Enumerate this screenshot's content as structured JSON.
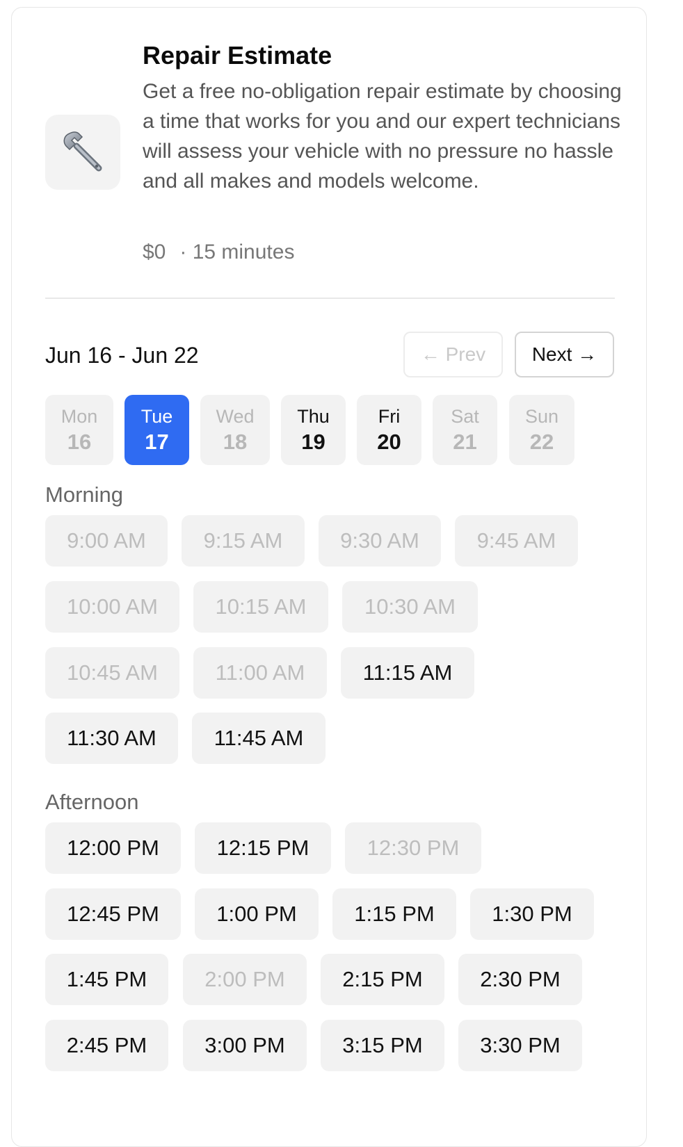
{
  "service": {
    "icon": "wrench-icon",
    "title": "Repair Estimate",
    "description": "Get a free no-obligation repair estimate by choosing a time that works for you and our expert technicians will assess your vehicle with no pressure no hassle and all makes and models welcome.",
    "price": "$0",
    "duration": "· 15 minutes"
  },
  "week": {
    "range": "Jun 16 - Jun 22",
    "prev_label": "← Prev",
    "next_label": "Next →",
    "days": [
      {
        "name": "Mon",
        "num": "16",
        "state": "disabled"
      },
      {
        "name": "Tue",
        "num": "17",
        "state": "selected"
      },
      {
        "name": "Wed",
        "num": "18",
        "state": "disabled"
      },
      {
        "name": "Thu",
        "num": "19",
        "state": "enabled"
      },
      {
        "name": "Fri",
        "num": "20",
        "state": "enabled"
      },
      {
        "name": "Sat",
        "num": "21",
        "state": "disabled"
      },
      {
        "name": "Sun",
        "num": "22",
        "state": "disabled"
      }
    ]
  },
  "morning": {
    "label": "Morning",
    "slots": [
      {
        "time": "9:00 AM",
        "available": false
      },
      {
        "time": "9:15 AM",
        "available": false
      },
      {
        "time": "9:30 AM",
        "available": false
      },
      {
        "time": "9:45 AM",
        "available": false
      },
      {
        "time": "10:00 AM",
        "available": false
      },
      {
        "time": "10:15 AM",
        "available": false
      },
      {
        "time": "10:30 AM",
        "available": false
      },
      {
        "time": "10:45 AM",
        "available": false
      },
      {
        "time": "11:00 AM",
        "available": false
      },
      {
        "time": "11:15 AM",
        "available": true
      },
      {
        "time": "11:30 AM",
        "available": true
      },
      {
        "time": "11:45 AM",
        "available": true
      }
    ]
  },
  "afternoon": {
    "label": "Afternoon",
    "slots": [
      {
        "time": "12:00 PM",
        "available": true
      },
      {
        "time": "12:15 PM",
        "available": true
      },
      {
        "time": "12:30 PM",
        "available": false
      },
      {
        "time": "12:45 PM",
        "available": true
      },
      {
        "time": "1:00 PM",
        "available": true
      },
      {
        "time": "1:15 PM",
        "available": true
      },
      {
        "time": "1:30 PM",
        "available": true
      },
      {
        "time": "1:45 PM",
        "available": true
      },
      {
        "time": "2:00 PM",
        "available": false
      },
      {
        "time": "2:15 PM",
        "available": true
      },
      {
        "time": "2:30 PM",
        "available": true
      },
      {
        "time": "2:45 PM",
        "available": true
      },
      {
        "time": "3:00 PM",
        "available": true
      },
      {
        "time": "3:15 PM",
        "available": true
      },
      {
        "time": "3:30 PM",
        "available": true
      }
    ]
  },
  "colors": {
    "accent": "#2f6bf2",
    "slot_bg": "#f2f2f2",
    "disabled_text": "#bdbdbd"
  }
}
